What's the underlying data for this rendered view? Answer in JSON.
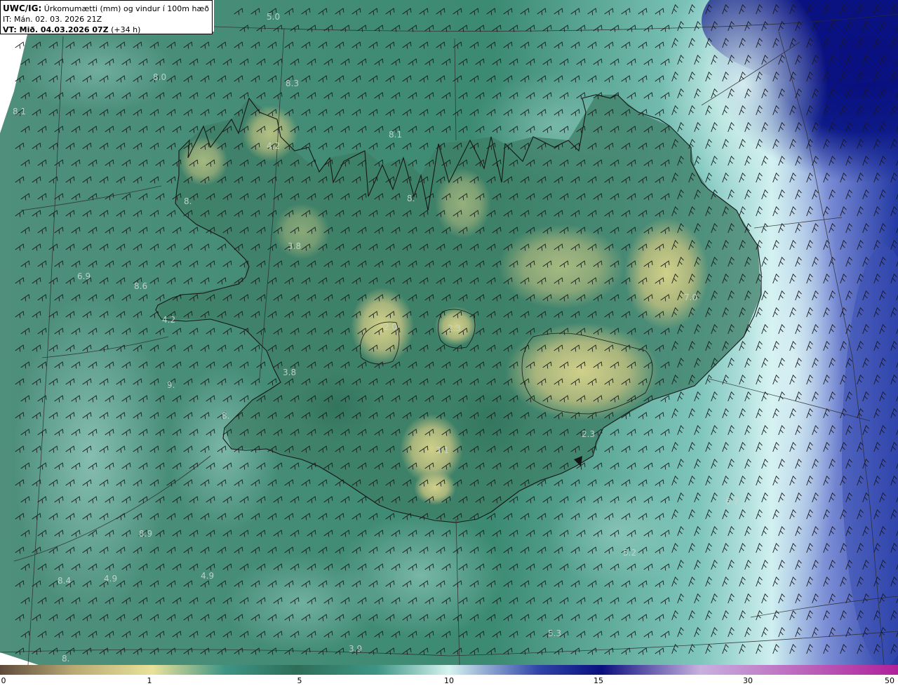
{
  "header": {
    "product": "UWC/IG:",
    "description": "Úrkomumætti (mm) og vindur í 100m hæð",
    "init_time": "IT: Mán. 02. 03. 2026 21Z",
    "valid_label": "VT: Mið. 04.03.2026 07Z",
    "lead": "(+34 h)"
  },
  "map_labels": [
    "5.0",
    "8.0",
    "8.3",
    "8.1",
    "8.1",
    "4.2",
    "8.",
    "8.",
    "3.8",
    "8.6",
    "4.2",
    "3.8",
    "2.0",
    "2.3",
    "7.0",
    "3.1",
    "2.3",
    "6.7",
    "5.2",
    "4.9",
    "4.9",
    "8.4",
    "3.9",
    "5.3",
    "8.9",
    "9.",
    "8.",
    "6.9",
    "8."
  ],
  "colorbar": {
    "ticks": [
      "0",
      "1",
      "5",
      "10",
      "15",
      "30",
      "50"
    ],
    "colors": {
      "brown": "#5e4a3a",
      "tan": "#b8a873",
      "yellow": "#e9e29a",
      "green": "#2e6e58",
      "teal": "#3e9585",
      "cyan": "#d6f4f0",
      "blue": "#2f44a8",
      "navy": "#0a0f7e",
      "lavender": "#c8b0e0",
      "magenta": "#b0209a"
    }
  }
}
